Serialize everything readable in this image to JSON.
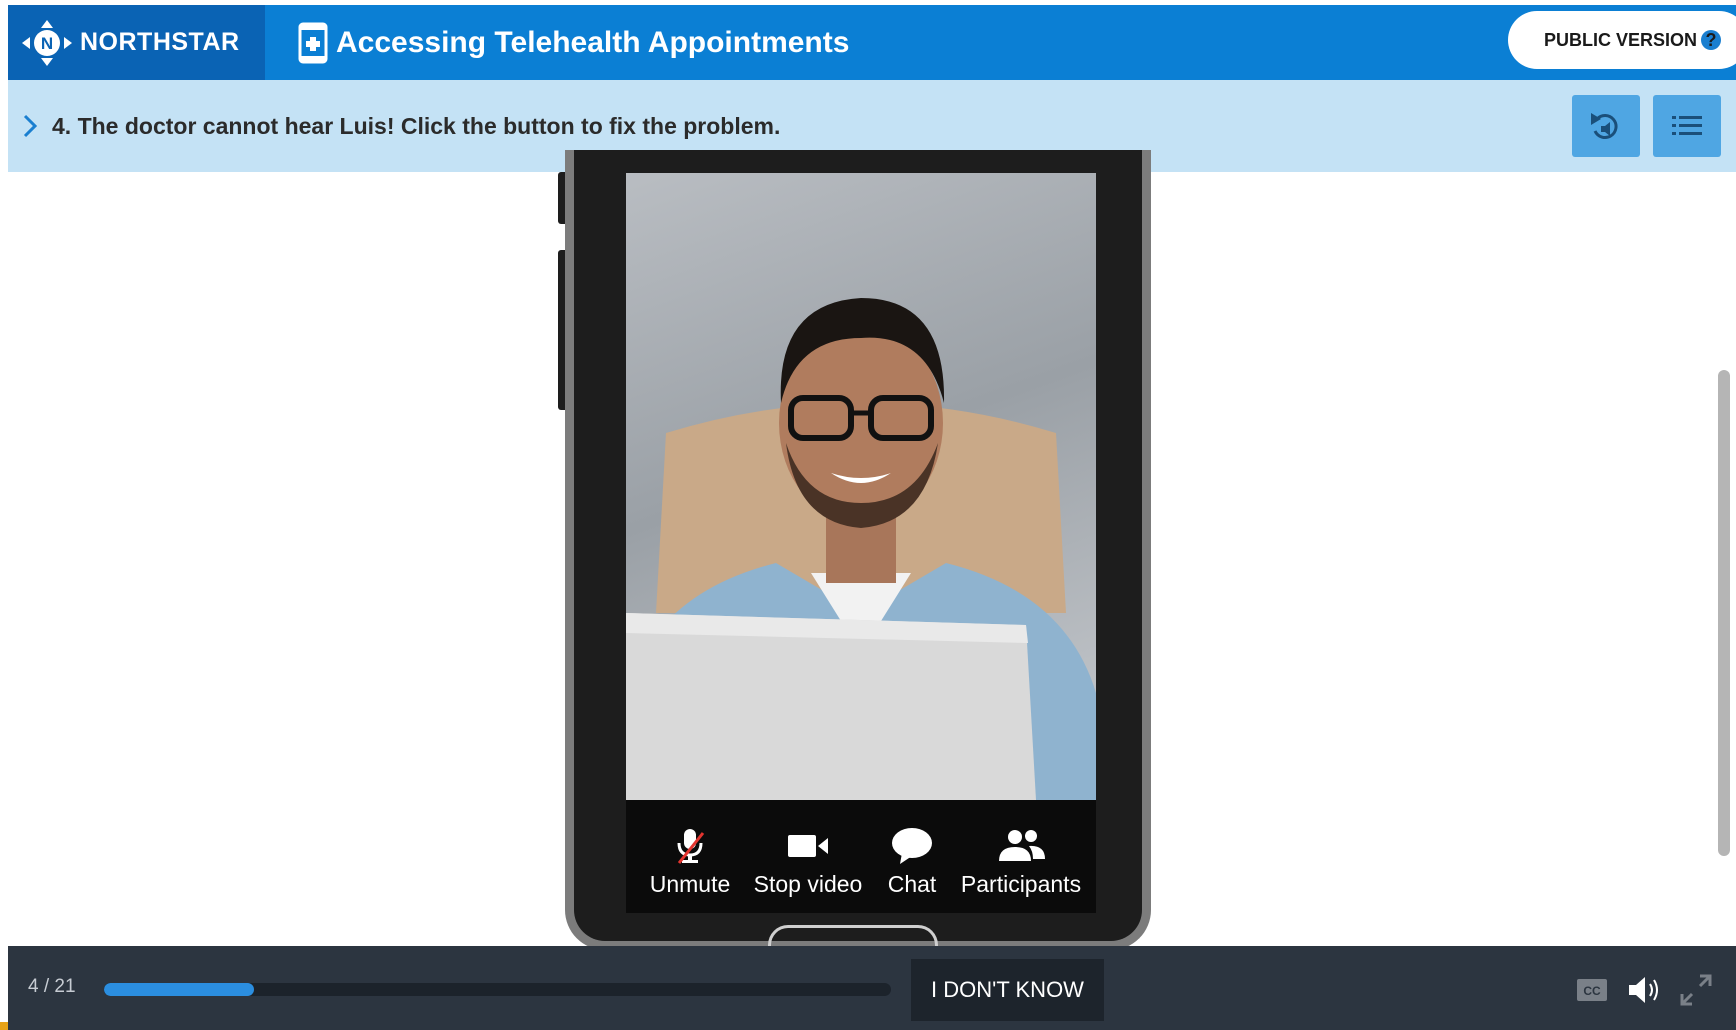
{
  "header": {
    "brand": "NORTHSTAR",
    "title": "Accessing Telehealth Appointments",
    "public_version_label": "PUBLIC VERSION",
    "help_icon": "?"
  },
  "instruction": {
    "text": "4. The doctor cannot hear Luis! Click the button to fix the problem.",
    "replay_audio_icon": "replay-audio-icon",
    "menu_icon": "list-menu-icon"
  },
  "phone": {
    "video_subject": "video-feed",
    "controls": [
      {
        "label": "Unmute",
        "icon": "muted-microphone-icon"
      },
      {
        "label": "Stop video",
        "icon": "video-camera-icon"
      },
      {
        "label": "Chat",
        "icon": "chat-bubble-icon"
      },
      {
        "label": "Participants",
        "icon": "participants-icon"
      }
    ]
  },
  "footer": {
    "progress_label": "4 / 21",
    "progress_fraction": 0.19,
    "dont_know_label": "I DON'T KNOW",
    "icons": [
      "closed-captions-icon",
      "volume-icon",
      "fullscreen-icon"
    ]
  },
  "colors": {
    "header_blue": "#0b7fd4",
    "logo_blue": "#0a63b4",
    "instruction_bg": "#c4e2f5",
    "footer_bg": "#2c3540",
    "progress_fill": "#2b8ee0"
  }
}
